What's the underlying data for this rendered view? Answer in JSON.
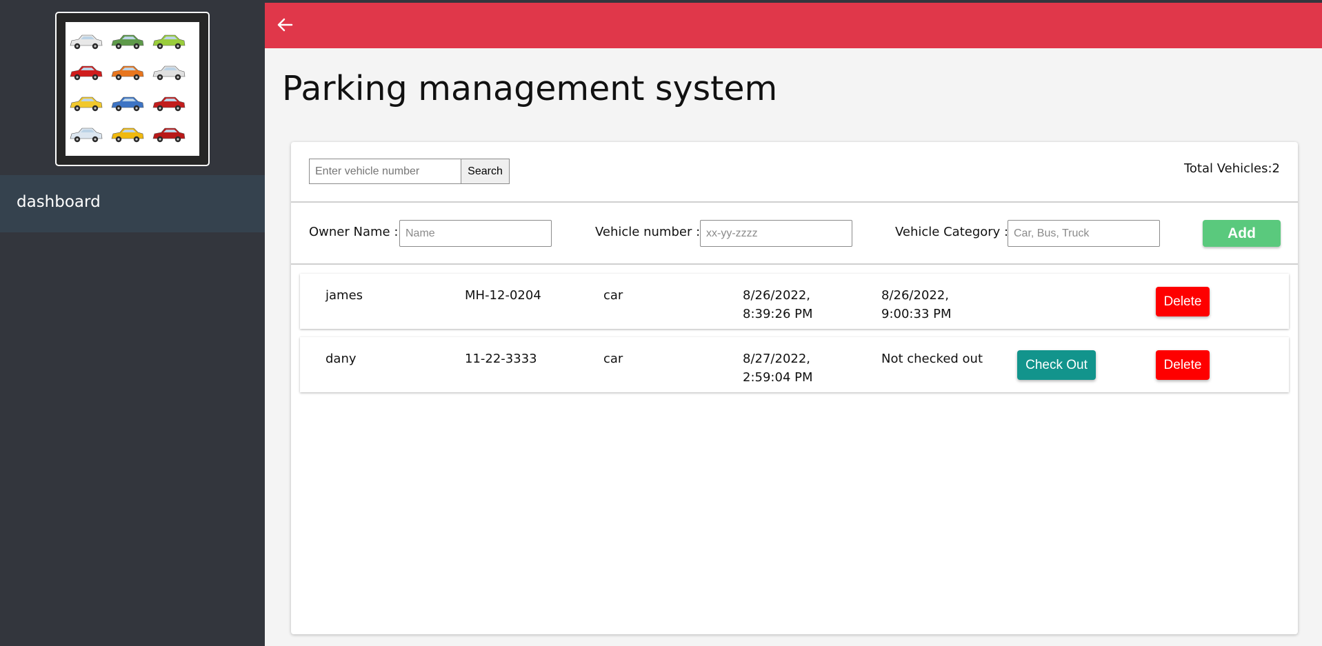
{
  "sidebar": {
    "logo_alt": "Car icons collection logo",
    "items": [
      {
        "label": "dashboard"
      }
    ]
  },
  "header": {
    "back_icon": "arrow-left-icon",
    "bar_color": "#e0374a"
  },
  "page": {
    "title": "Parking management system"
  },
  "search": {
    "placeholder": "Enter vehicle number",
    "value": "",
    "button_label": "Search",
    "total_label": "Total Vehicles:2"
  },
  "form": {
    "owner_label": "Owner Name :",
    "owner_placeholder": "Name",
    "vehicle_label": "Vehicle number :",
    "vehicle_placeholder": "xx-yy-zzzz",
    "category_label": "Vehicle Category :",
    "category_placeholder": "Car, Bus, Truck",
    "add_label": "Add"
  },
  "rows": [
    {
      "owner": "james",
      "number": "MH-12-0204",
      "category": "car",
      "checkin_date": "8/26/2022,",
      "checkin_time": "8:39:26 PM",
      "checkout_date": "8/26/2022,",
      "checkout_time": "9:00:33 PM",
      "delete_label": "Delete"
    },
    {
      "owner": "dany",
      "number": "11-22-3333",
      "category": "car",
      "checkin_date": "8/27/2022,",
      "checkin_time": "2:59:04 PM",
      "checkout_status": "Not checked out",
      "checkout_label": "Check Out",
      "delete_label": "Delete"
    }
  ],
  "colors": {
    "sidebar": "#33363d",
    "sidebar_active": "#35424e",
    "accent": "#e0374a",
    "add": "#5ac97d",
    "delete": "#fe0000",
    "checkout": "#12948c"
  }
}
